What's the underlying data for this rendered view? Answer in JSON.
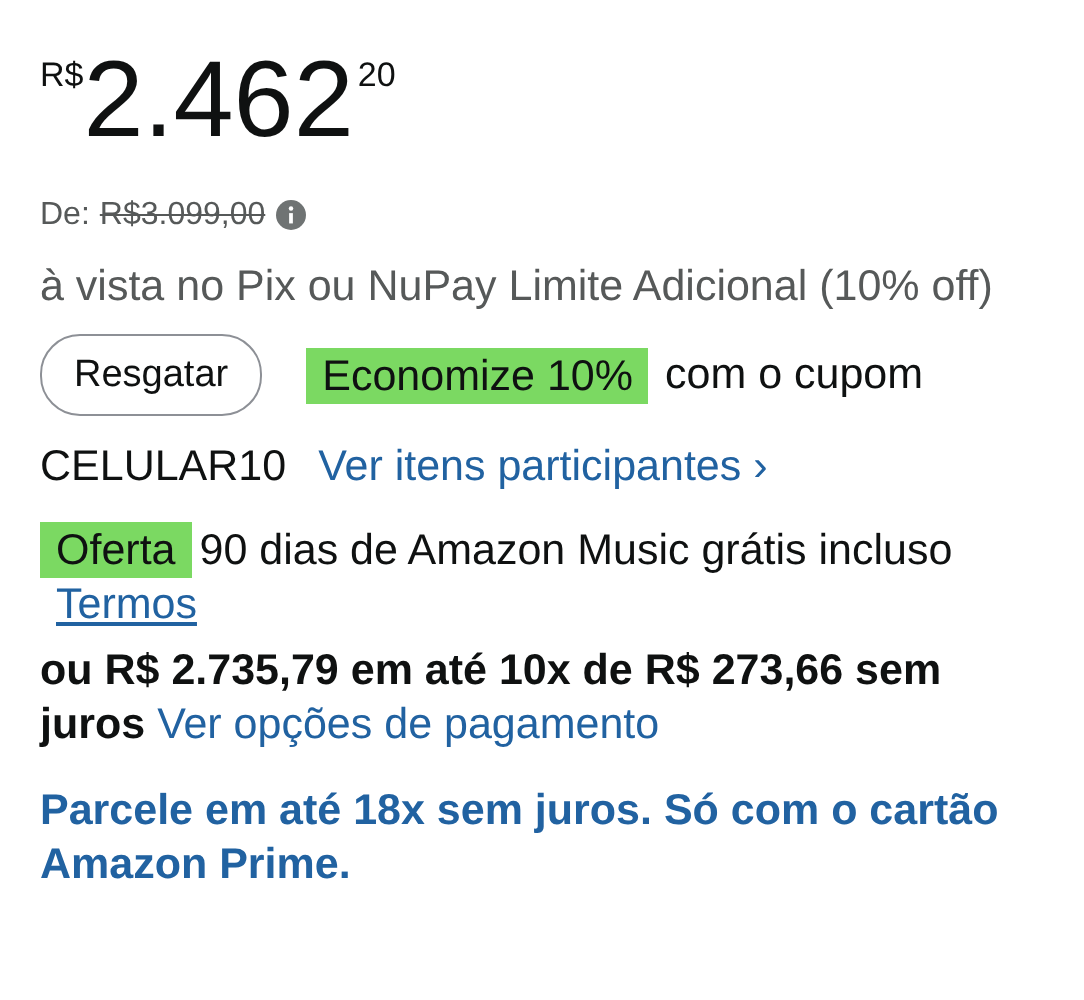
{
  "price": {
    "currency": "R$",
    "whole": "2.462",
    "cents": "20"
  },
  "list_price": {
    "label": "De:",
    "value": "R$3.099,00",
    "struck": true
  },
  "payment_note": "à vista no Pix ou NuPay Limite Adicional (10% off)",
  "coupon": {
    "button": "Resgatar",
    "badge": "Economize 10%",
    "text": "com o cupom",
    "code": "CELULAR10",
    "link": "Ver itens participantes",
    "chevron": "›"
  },
  "offer": {
    "badge": "Oferta",
    "text": "90 dias de Amazon Music grátis incluso",
    "link": "Termos"
  },
  "installments": {
    "text": "ou R$ 2.735,79 em até 10x de R$ 273,66 sem juros",
    "link": "Ver opções de pagamento"
  },
  "prime_offer": "Parcele em até 18x sem juros. Só com o cartão Amazon Prime."
}
